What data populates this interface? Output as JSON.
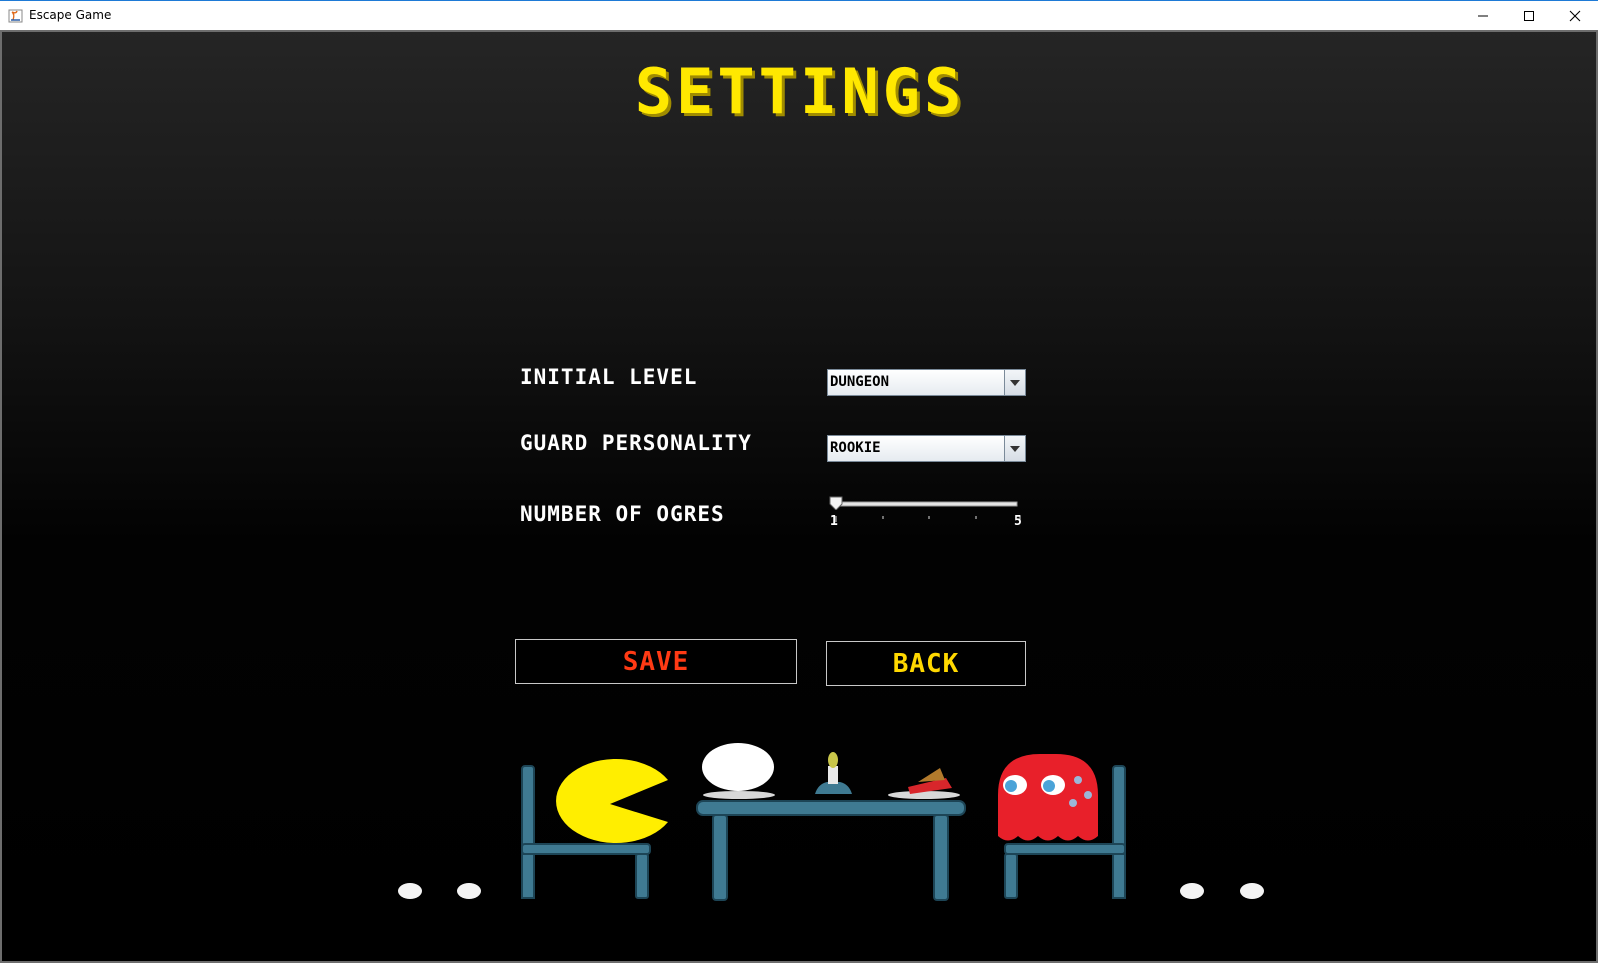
{
  "window": {
    "title": "Escape Game"
  },
  "page": {
    "title": "SETTINGS"
  },
  "settings": {
    "initial_level": {
      "label": "INITIAL LEVEL",
      "selected": "DUNGEON"
    },
    "guard_personality": {
      "label": "GUARD PERSONALITY",
      "selected": "ROOKIE"
    },
    "number_of_ogres": {
      "label": "NUMBER OF OGRES",
      "min_label": "1",
      "max_label": "5",
      "value": 1
    }
  },
  "buttons": {
    "save": "SAVE",
    "back": "BACK"
  },
  "colors": {
    "title": "#ffe800",
    "save": "#ff3a14",
    "back": "#ffd800",
    "pacman": "#ffee00",
    "ghost": "#e8202a",
    "furniture": "#3f7a92"
  }
}
